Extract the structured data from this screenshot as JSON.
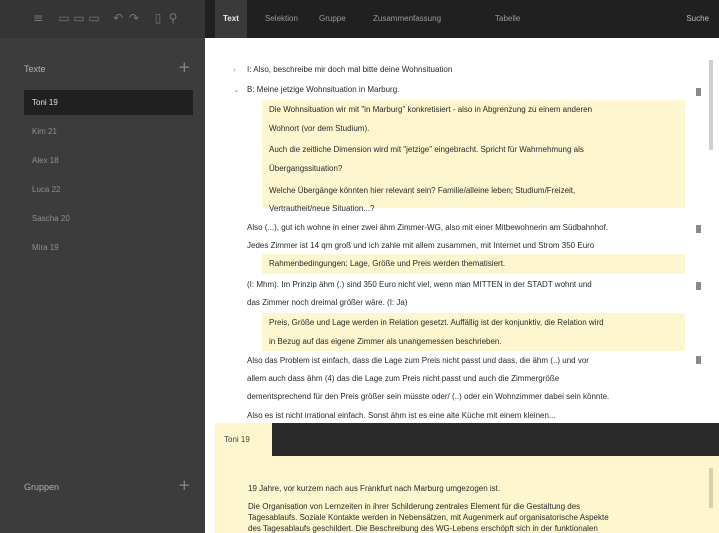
{
  "sidebar": {
    "texts_heading": "Texte",
    "groups_heading": "Gruppen",
    "texts": [
      "Toni 19",
      "Kim 21",
      "Alex 18",
      "Luca 22",
      "Sascha 20",
      "Mira 19"
    ]
  },
  "nav": {
    "tabs": [
      "Text",
      "Selektion",
      "Gruppe",
      "Zusammenfassung",
      "Tabelle"
    ],
    "search": "Suche"
  },
  "transcript": {
    "lines": [
      "I: Also, beschreibe mir doch mal bitte deine Wohnsituation",
      "B: Meine jetzige Wohnsituation in Marburg.",
      "Die Wohnsituation wir mit \"in Marburg\" konkretisiert - also in Abgrenzung zu einem anderen",
      "Wohnort (vor dem Studium).",
      "Auch die zeitliche Dimension wird mit \"jetzige\" eingebracht. Spricht für Wahrnehmung als",
      "Übergangssituation?",
      "Welche Übergänge könnten hier relevant sein? Familie/alleine leben; Studium/Freizeit,",
      "Vertrautheit/neue Situation...?",
      "Also (...), gut ich wohne in einer zwei ähm Zimmer-WG, also mit einer Mitbewohnerin am Südbahnhof.",
      "Jedes Zimmer ist 14 qm groß und ich zahle mit allem zusammen, mit Internet und Strom 350 Euro",
      "Rahmenbedingungen: Lage, Größe und Preis werden thematisiert.",
      "(I: Mhm). Im Prinzip ähm (.) sind 350 Euro nicht viel, wenn man MITTEN in der STADT wohnt und",
      "das Zimmer noch dreimal größer wäre. (I: Ja)",
      "Preis, Größe und Lage werden in Relation gesetzt. Auffällig ist der konjunktiv, die Relation wird",
      "in Bezug auf das eigene Zimmer als unangemessen beschrieben.",
      "Also das Problem ist einfach, dass die Lage zum Preis nicht passt und dass, die ähm (..) und vor",
      "allem auch dass ähm (4) das die Lage zum Preis nicht passt und auch die Zimmergröße",
      "dementsprechend für den Preis größer sein müsste oder/ (..) oder ein Wohnzimmer dabei sein könnte.",
      "Also es ist nicht irrational einfach. Sonst ähm ist es eine alte Küche mit einem kleinen..."
    ]
  },
  "document": {
    "tab_label": "Toni 19",
    "lines": [
      "19 Jahre, vor kurzem nach aus Frankfurt nach Marburg umgezogen ist.",
      "Die Organisation von Lernzeiten in ihrer Schilderung zentrales Element für die Gestaltung des",
      "Tagesablaufs. Soziale Kontakte werden in Nebensätzen, mit Augenmerk auf organisatorische Aspekte",
      "des Tagesablaufs geschildert. Die Beschreibung des WG-Lebens erschöpft sich in der funktionalen"
    ]
  },
  "colors": {
    "sidebar": "#3c3c3c",
    "nav": "#202020",
    "active_item": "#202020",
    "comment_highlight": "#fdf6cf"
  },
  "icons": [
    "menu-icon",
    "new-document-icon",
    "save-document-icon",
    "edit-document-icon",
    "undo-icon",
    "redo-icon",
    "phone-icon",
    "search-icon",
    "add-icon",
    "note-pin-icon"
  ]
}
